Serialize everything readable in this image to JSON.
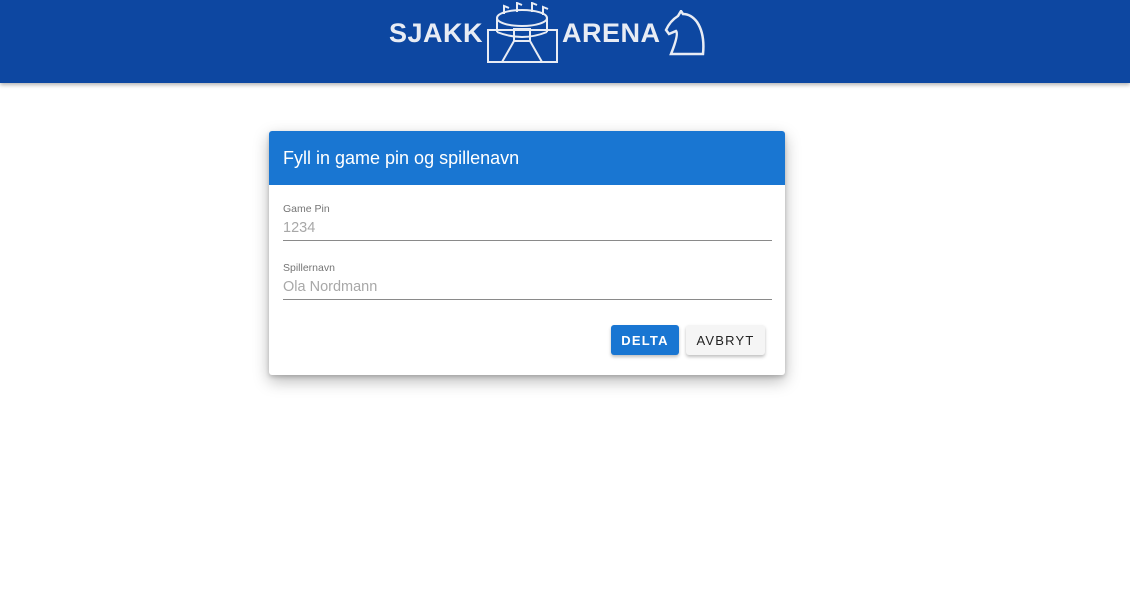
{
  "header": {
    "logo_text_left": "SJAKK",
    "logo_text_right": "ARENA",
    "logo_icons": [
      "stadium-icon",
      "knight-icon"
    ],
    "background_color": "#0d47a1"
  },
  "dialog": {
    "title": "Fyll in game pin og spillenavn",
    "header_color": "#1976d2",
    "fields": [
      {
        "label": "Game Pin",
        "placeholder": "1234",
        "value": ""
      },
      {
        "label": "Spillernavn",
        "placeholder": "Ola Nordmann",
        "value": ""
      }
    ],
    "buttons": {
      "join": "DELTA",
      "cancel": "AVBRYT"
    }
  }
}
